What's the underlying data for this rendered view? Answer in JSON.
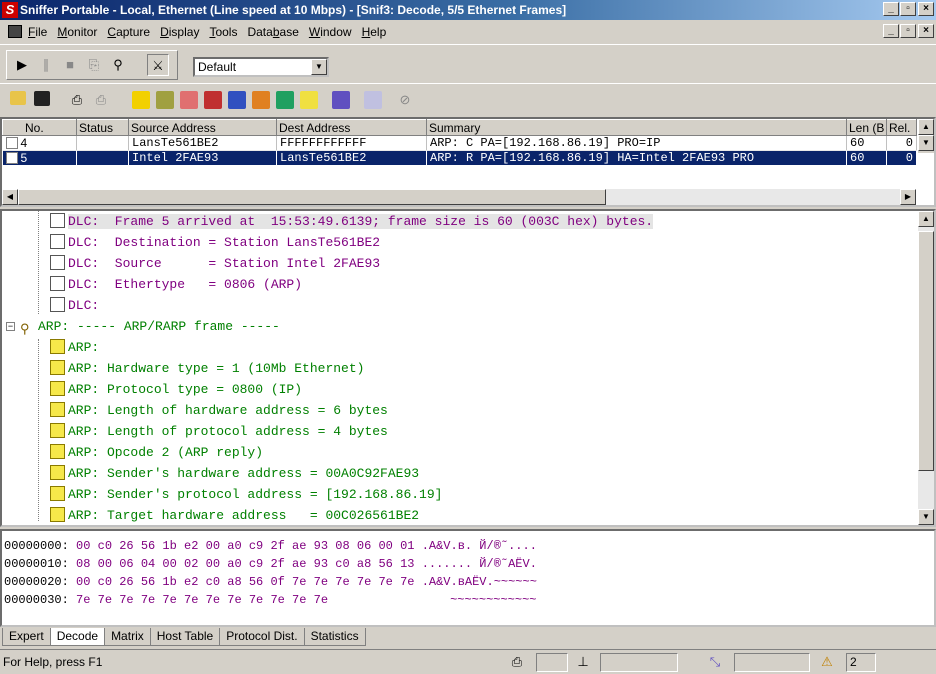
{
  "window": {
    "title": "Sniffer Portable - Local, Ethernet (Line speed at 10 Mbps) - [Snif3: Decode, 5/5 Ethernet Frames]",
    "app_icon_letter": "S",
    "controls": [
      "_",
      "×"
    ]
  },
  "menu": [
    {
      "label": "File",
      "ul": "F",
      "rest": "ile"
    },
    {
      "label": "Monitor",
      "ul": "M",
      "rest": "onitor"
    },
    {
      "label": "Capture",
      "ul": "C",
      "rest": "apture"
    },
    {
      "label": "Display",
      "ul": "D",
      "rest": "isplay"
    },
    {
      "label": "Tools",
      "ul": "T",
      "rest": "ools"
    },
    {
      "label": "Database",
      "pre": "Data",
      "ul": "b",
      "rest": "ase"
    },
    {
      "label": "Window",
      "ul": "W",
      "rest": "indow"
    },
    {
      "label": "Help",
      "ul": "H",
      "rest": "elp"
    }
  ],
  "toolbar": {
    "profile_combo_value": "Default"
  },
  "summary": {
    "columns": [
      "No.",
      "Status",
      "Source Address",
      "Dest Address",
      "Summary",
      "Len (B",
      "Rel."
    ],
    "rows": [
      {
        "no": "4",
        "status": "",
        "src": "LansTe561BE2",
        "dst": "FFFFFFFFFFFF",
        "summary": "ARP: C PA=[192.168.86.19] PRO=IP",
        "len": "60",
        "rel": "0",
        "selected": false
      },
      {
        "no": "5",
        "status": "",
        "src": "Intel 2FAE93",
        "dst": "LansTe561BE2",
        "summary": "ARP: R PA=[192.168.86.19] HA=Intel 2FAE93 PRO",
        "len": "60",
        "rel": "0",
        "selected": true
      }
    ]
  },
  "decode": {
    "dlc": [
      "DLC:  Frame 5 arrived at  15:53:49.6139; frame size is 60 (003C hex) bytes.",
      "DLC:  Destination = Station LansTe561BE2",
      "DLC:  Source      = Station Intel 2FAE93",
      "DLC:  Ethertype   = 0806 (ARP)",
      "DLC:"
    ],
    "arp_header": "ARP: ----- ARP/RARP frame -----",
    "arp": [
      "ARP:",
      "ARP: Hardware type = 1 (10Mb Ethernet)",
      "ARP: Protocol type = 0800 (IP)",
      "ARP: Length of hardware address = 6 bytes",
      "ARP: Length of protocol address = 4 bytes",
      "ARP: Opcode 2 (ARP reply)",
      "ARP: Sender's hardware address = 00A0C92FAE93",
      "ARP: Sender's protocol address = [192.168.86.19]",
      "ARP: Target hardware address   = 00C026561BE2"
    ]
  },
  "hex": [
    {
      "offset": "00000000:",
      "bytes": "00 c0 26 56 1b e2 00 a0 c9 2f ae 93 08 06 00 01",
      "ascii": ".A&V.в. Й/®˜...."
    },
    {
      "offset": "00000010:",
      "bytes": "08 00 06 04 00 02 00 a0 c9 2f ae 93 c0 a8 56 13",
      "ascii": "....... Й/®˜AЁV."
    },
    {
      "offset": "00000020:",
      "bytes": "00 c0 26 56 1b e2 c0 a8 56 0f 7e 7e 7e 7e 7e 7e",
      "ascii": ".A&V.вAЁV.~~~~~~"
    },
    {
      "offset": "00000030:",
      "bytes": "7e 7e 7e 7e 7e 7e 7e 7e 7e 7e 7e 7e",
      "ascii": "~~~~~~~~~~~~"
    }
  ],
  "tabs": [
    "Expert",
    "Decode",
    "Matrix",
    "Host Table",
    "Protocol Dist.",
    "Statistics"
  ],
  "active_tab": "Decode",
  "status": {
    "help_text": "For Help, press F1",
    "alarm_count": "2"
  }
}
